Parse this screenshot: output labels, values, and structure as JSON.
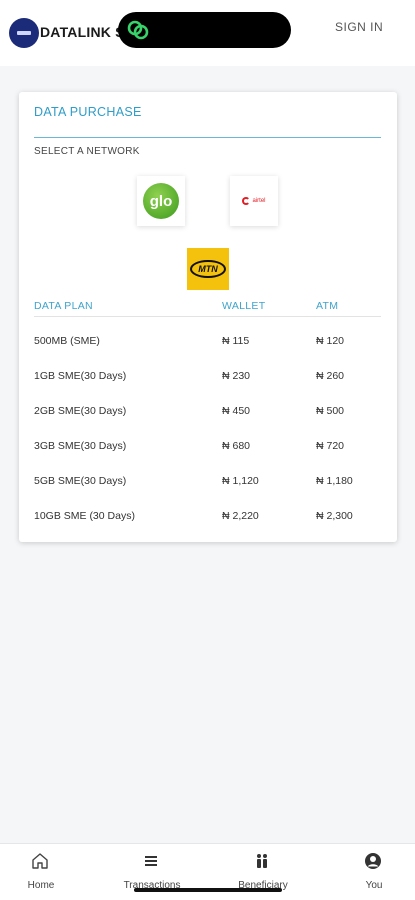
{
  "header": {
    "brand": "DATALINK S",
    "sign_in": "SIGN IN"
  },
  "card": {
    "title": "DATA PURCHASE",
    "select_label": "SELECT A NETWORK",
    "networks": [
      {
        "name": "glo",
        "logo_text": "glo"
      },
      {
        "name": "airtel",
        "logo_text": "airtel"
      },
      {
        "name": "mtn",
        "logo_text": "MTN"
      }
    ],
    "table": {
      "headers": [
        "DATA PLAN",
        "WALLET",
        "ATM"
      ],
      "rows": [
        [
          "500MB (SME)",
          "₦ 115",
          "₦ 120"
        ],
        [
          "1GB SME(30 Days)",
          "₦ 230",
          "₦ 260"
        ],
        [
          "2GB SME(30 Days)",
          "₦ 450",
          "₦ 500"
        ],
        [
          "3GB SME(30 Days)",
          "₦ 680",
          "₦ 720"
        ],
        [
          "5GB SME(30 Days)",
          "₦ 1,120",
          "₦ 1,180"
        ],
        [
          "10GB SME (30 Days)",
          "₦ 2,220",
          "₦ 2,300"
        ]
      ]
    }
  },
  "nav": [
    {
      "label": "Home",
      "icon": "home-icon"
    },
    {
      "label": "Transactions",
      "icon": "list-icon"
    },
    {
      "label": "Beneficiary",
      "icon": "people-icon"
    },
    {
      "label": "You",
      "icon": "user-icon"
    }
  ],
  "colors": {
    "accent": "#2f9dc8",
    "glo": "#3d9a1d",
    "airtel": "#e31e24",
    "mtn": "#f4c20d",
    "logo_bg": "#1c2a7a"
  }
}
